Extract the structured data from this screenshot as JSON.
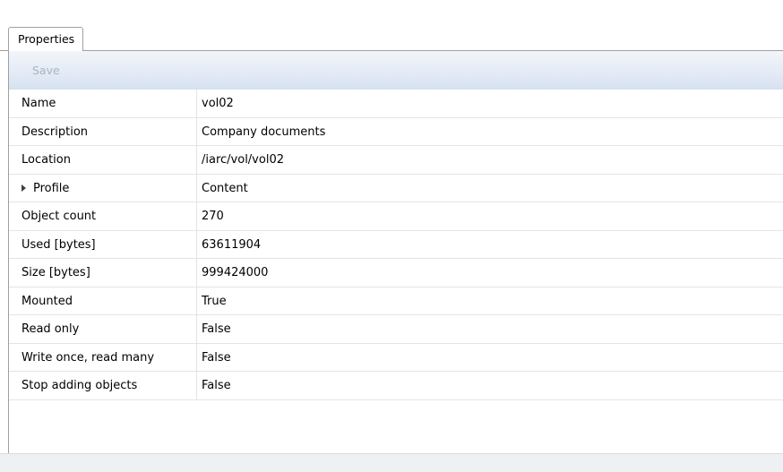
{
  "tabs": [
    {
      "label": "Properties",
      "active": true
    }
  ],
  "toolbar": {
    "save_label": "Save",
    "save_enabled": false
  },
  "properties": [
    {
      "key": "Name",
      "value": "vol02"
    },
    {
      "key": "Description",
      "value": "Company documents"
    },
    {
      "key": "Location",
      "value": "/iarc/vol/vol02"
    },
    {
      "key": "Profile",
      "value": "Content",
      "expandable": true
    },
    {
      "key": "Object count",
      "value": "270"
    },
    {
      "key": "Used [bytes]",
      "value": "63611904"
    },
    {
      "key": "Size [bytes]",
      "value": "999424000"
    },
    {
      "key": "Mounted",
      "value": "True"
    },
    {
      "key": "Read only",
      "value": "False"
    },
    {
      "key": "Write once, read many",
      "value": "False"
    },
    {
      "key": "Stop adding objects",
      "value": "False"
    }
  ],
  "icons": {
    "expand": "triangle-right-icon"
  },
  "colors": {
    "toolbar_top": "#f2f5fa",
    "toolbar_bottom": "#d6e1f0",
    "disabled_text": "#a9b4c2",
    "grid_line": "#e4e4e4",
    "border": "#a0a0a0"
  }
}
